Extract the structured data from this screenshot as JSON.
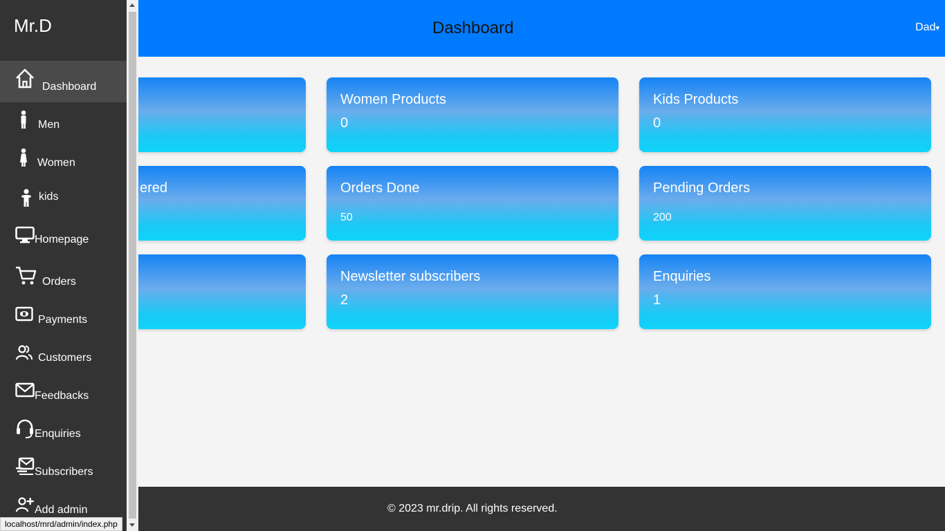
{
  "header": {
    "title": "Dashboard",
    "user_label": "Dad",
    "caret": "▾"
  },
  "sidebar": {
    "brand": "Mr.D",
    "items": [
      {
        "label": "Dashboard",
        "icon": "home-icon",
        "active": true
      },
      {
        "label": "Men",
        "icon": "man-icon"
      },
      {
        "label": "Women",
        "icon": "woman-icon"
      },
      {
        "label": "kids",
        "icon": "child-icon"
      },
      {
        "label": "Homepage",
        "icon": "monitor-icon"
      },
      {
        "label": "Orders",
        "icon": "cart-icon"
      },
      {
        "label": "Payments",
        "icon": "cash-icon"
      },
      {
        "label": "Customers",
        "icon": "people-icon"
      },
      {
        "label": "Feedbacks",
        "icon": "envelope-icon"
      },
      {
        "label": "Enquiries",
        "icon": "headset-icon"
      },
      {
        "label": "Subscribers",
        "icon": "mail-fast-icon"
      },
      {
        "label": "Add admin",
        "icon": "person-add-icon"
      }
    ]
  },
  "cards": [
    {
      "title": "",
      "value": ""
    },
    {
      "title": "Women Products",
      "value": "0"
    },
    {
      "title": "Kids Products",
      "value": "0"
    },
    {
      "title": "ered",
      "value": ""
    },
    {
      "title": "Orders Done",
      "value": "50"
    },
    {
      "title": "Pending Orders",
      "value": "200"
    },
    {
      "title": "",
      "value": ""
    },
    {
      "title": "Newsletter subscribers",
      "value": "2"
    },
    {
      "title": "Enquiries",
      "value": "1"
    }
  ],
  "footer": {
    "text": "© 2023 mr.drip. All rights reserved."
  },
  "status_bar": {
    "url": "localhost/mrd/admin/index.php"
  },
  "colors": {
    "header": "#007bff",
    "sidebar": "#333333",
    "card_top": "#1583f5",
    "card_bottom": "#10d4fb"
  }
}
